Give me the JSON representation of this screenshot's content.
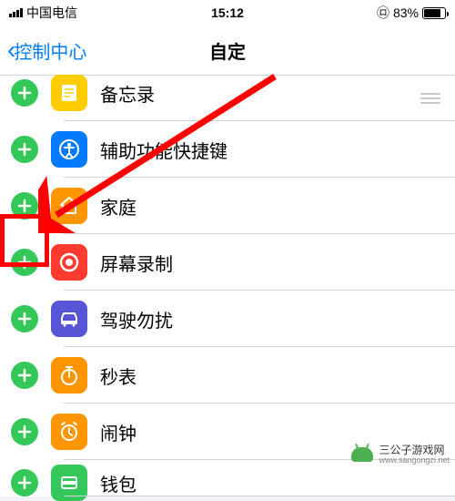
{
  "status": {
    "carrier": "中国电信",
    "time": "15:12",
    "battery_pct": "83%",
    "battery_fill_width": "83%"
  },
  "nav": {
    "back_label": "控制中心",
    "title": "自定"
  },
  "items": [
    {
      "label": "备忘录",
      "icon_bg": "#ffcc00",
      "icon": "note"
    },
    {
      "label": "辅助功能快捷键",
      "icon_bg": "#007aff",
      "icon": "accessibility"
    },
    {
      "label": "家庭",
      "icon_bg": "#ff9500",
      "icon": "home"
    },
    {
      "label": "屏幕录制",
      "icon_bg": "#ff3b30",
      "icon": "record"
    },
    {
      "label": "驾驶勿扰",
      "icon_bg": "#5856d6",
      "icon": "car"
    },
    {
      "label": "秒表",
      "icon_bg": "#ff9500",
      "icon": "stopwatch"
    },
    {
      "label": "闹钟",
      "icon_bg": "#ff9500",
      "icon": "alarm"
    },
    {
      "label": "钱包",
      "icon_bg": "#34c759",
      "icon": "wallet"
    }
  ],
  "watermark": {
    "title": "三公子游戏网",
    "url": "www.sangongzi.net"
  }
}
